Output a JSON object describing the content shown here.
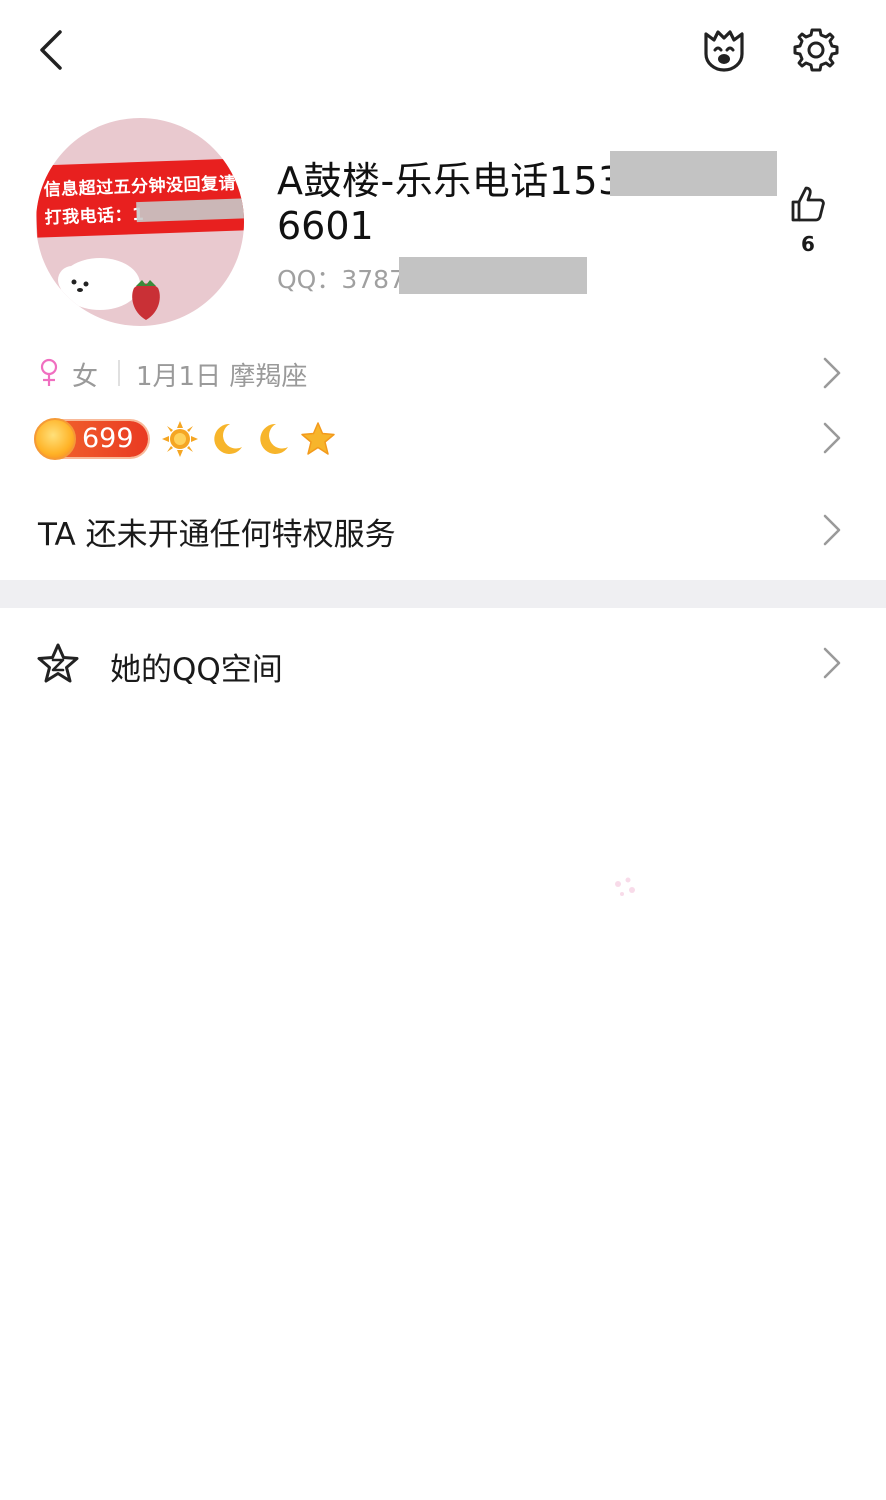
{
  "profile": {
    "name_line1": "A鼓楼-乐乐电话153",
    "name_line2": "6601",
    "qq": "QQ：3787",
    "likes": "6",
    "avatar_text_line1": "信息超过五分钟没回复请",
    "avatar_text_line2": "打我电话：1"
  },
  "info": {
    "gender": "女",
    "birthday": "1月1日  摩羯座"
  },
  "level": {
    "value": "699",
    "icons": [
      "sun-icon",
      "moon-icon",
      "moon-icon",
      "star-icon"
    ]
  },
  "privilege": {
    "text": "TA 还未开通任何特权服务"
  },
  "qzone": {
    "label": "她的QQ空间"
  },
  "colors": {
    "accent_female": "#f06fc0",
    "level_badge": "#ee4a25",
    "section_gap": "#efeff2"
  }
}
